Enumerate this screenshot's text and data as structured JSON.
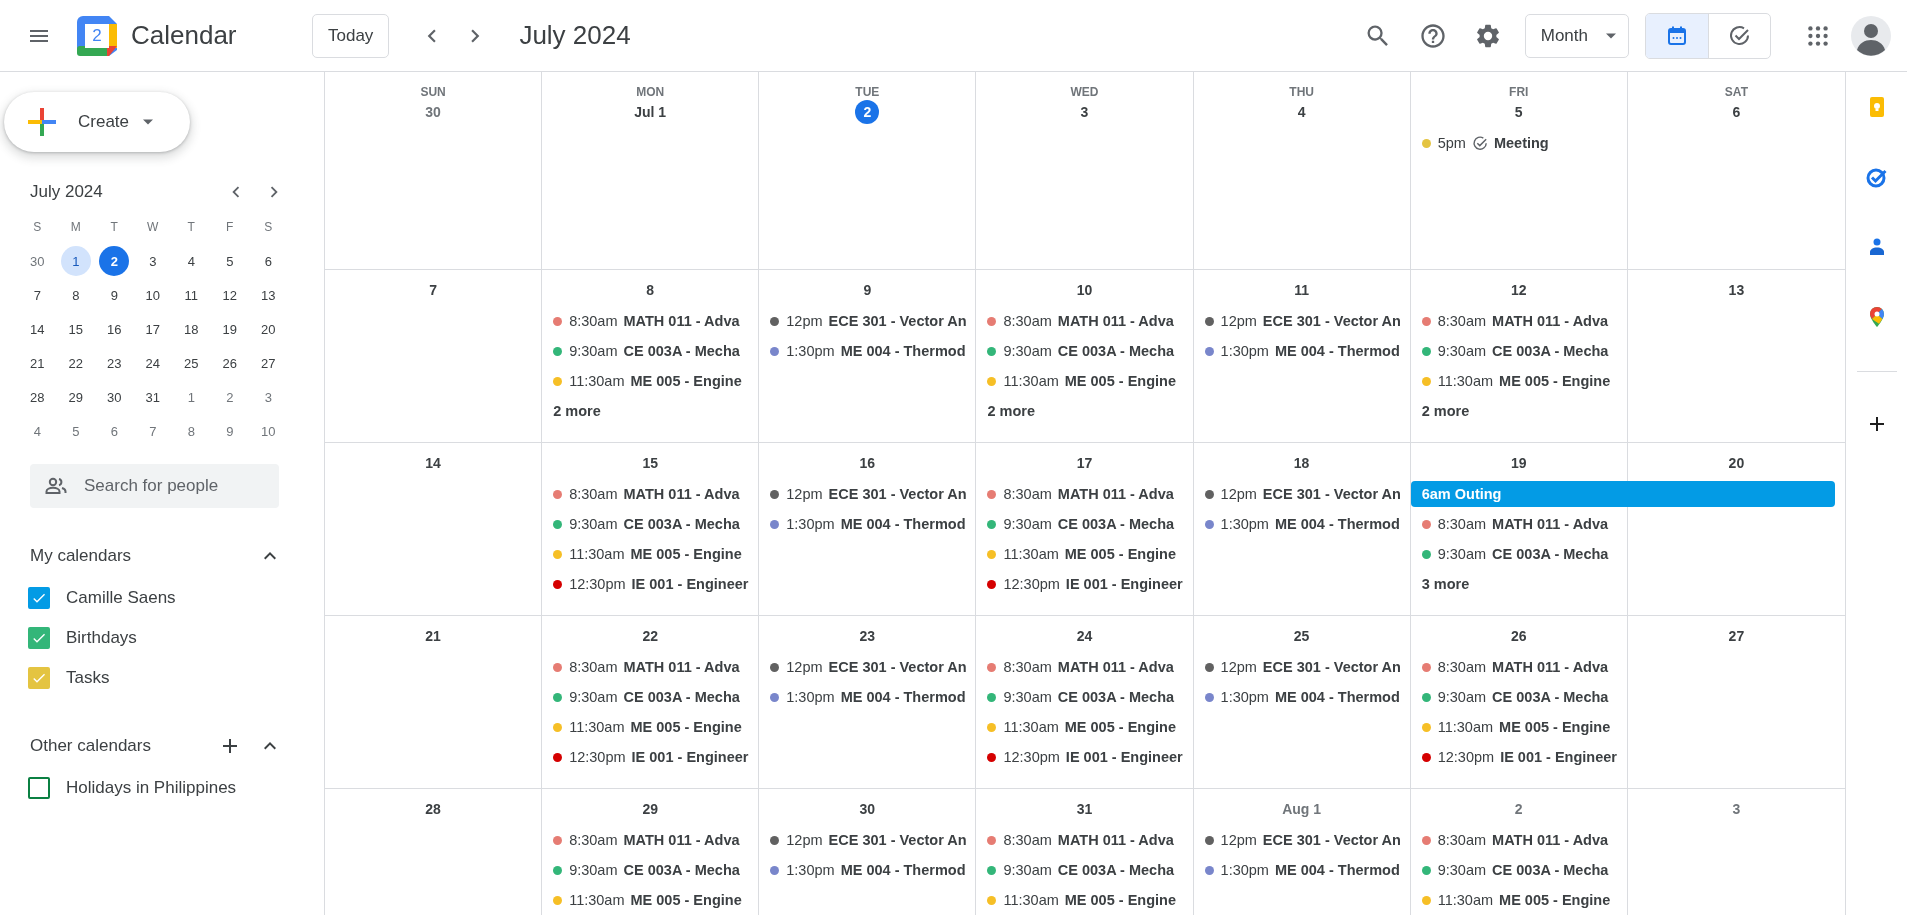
{
  "topbar": {
    "logo_date": "2",
    "app_name": "Calendar",
    "today_button": "Today",
    "title": "July 2024",
    "view_select": "Month",
    "view_toggle": [
      {
        "kind": "calendar",
        "selected": true
      },
      {
        "kind": "tasks",
        "selected": false
      }
    ]
  },
  "sidebar": {
    "create_button": "Create",
    "mini_calendar": {
      "title": "July 2024",
      "weekdays": [
        "S",
        "M",
        "T",
        "W",
        "T",
        "F",
        "S"
      ],
      "weeks": [
        [
          {
            "label": "30",
            "other_month": true,
            "selected": false,
            "today": false
          },
          {
            "label": "1",
            "other_month": false,
            "selected": true,
            "today": false
          },
          {
            "label": "2",
            "other_month": false,
            "selected": false,
            "today": true
          },
          {
            "label": "3",
            "other_month": false,
            "selected": false,
            "today": false
          },
          {
            "label": "4",
            "other_month": false,
            "selected": false,
            "today": false
          },
          {
            "label": "5",
            "other_month": false,
            "selected": false,
            "today": false
          },
          {
            "label": "6",
            "other_month": false,
            "selected": false,
            "today": false
          }
        ],
        [
          {
            "label": "7",
            "other_month": false,
            "selected": false,
            "today": false
          },
          {
            "label": "8",
            "other_month": false,
            "selected": false,
            "today": false
          },
          {
            "label": "9",
            "other_month": false,
            "selected": false,
            "today": false
          },
          {
            "label": "10",
            "other_month": false,
            "selected": false,
            "today": false
          },
          {
            "label": "11",
            "other_month": false,
            "selected": false,
            "today": false
          },
          {
            "label": "12",
            "other_month": false,
            "selected": false,
            "today": false
          },
          {
            "label": "13",
            "other_month": false,
            "selected": false,
            "today": false
          }
        ],
        [
          {
            "label": "14",
            "other_month": false,
            "selected": false,
            "today": false
          },
          {
            "label": "15",
            "other_month": false,
            "selected": false,
            "today": false
          },
          {
            "label": "16",
            "other_month": false,
            "selected": false,
            "today": false
          },
          {
            "label": "17",
            "other_month": false,
            "selected": false,
            "today": false
          },
          {
            "label": "18",
            "other_month": false,
            "selected": false,
            "today": false
          },
          {
            "label": "19",
            "other_month": false,
            "selected": false,
            "today": false
          },
          {
            "label": "20",
            "other_month": false,
            "selected": false,
            "today": false
          }
        ],
        [
          {
            "label": "21",
            "other_month": false,
            "selected": false,
            "today": false
          },
          {
            "label": "22",
            "other_month": false,
            "selected": false,
            "today": false
          },
          {
            "label": "23",
            "other_month": false,
            "selected": false,
            "today": false
          },
          {
            "label": "24",
            "other_month": false,
            "selected": false,
            "today": false
          },
          {
            "label": "25",
            "other_month": false,
            "selected": false,
            "today": false
          },
          {
            "label": "26",
            "other_month": false,
            "selected": false,
            "today": false
          },
          {
            "label": "27",
            "other_month": false,
            "selected": false,
            "today": false
          }
        ],
        [
          {
            "label": "28",
            "other_month": false,
            "selected": false,
            "today": false
          },
          {
            "label": "29",
            "other_month": false,
            "selected": false,
            "today": false
          },
          {
            "label": "30",
            "other_month": false,
            "selected": false,
            "today": false
          },
          {
            "label": "31",
            "other_month": false,
            "selected": false,
            "today": false
          },
          {
            "label": "1",
            "other_month": true,
            "selected": false,
            "today": false
          },
          {
            "label": "2",
            "other_month": true,
            "selected": false,
            "today": false
          },
          {
            "label": "3",
            "other_month": true,
            "selected": false,
            "today": false
          }
        ],
        [
          {
            "label": "4",
            "other_month": true,
            "selected": false,
            "today": false
          },
          {
            "label": "5",
            "other_month": true,
            "selected": false,
            "today": false
          },
          {
            "label": "6",
            "other_month": true,
            "selected": false,
            "today": false
          },
          {
            "label": "7",
            "other_month": true,
            "selected": false,
            "today": false
          },
          {
            "label": "8",
            "other_month": true,
            "selected": false,
            "today": false
          },
          {
            "label": "9",
            "other_month": true,
            "selected": false,
            "today": false
          },
          {
            "label": "10",
            "other_month": true,
            "selected": false,
            "today": false
          }
        ]
      ]
    },
    "people_search": {
      "placeholder": "Search for people"
    },
    "calendar_groups": [
      {
        "title": "My calendars",
        "expanded": true,
        "can_add": false,
        "items": [
          {
            "label": "Camille Saens",
            "checked": true,
            "color": "#039be5"
          },
          {
            "label": "Birthdays",
            "checked": true,
            "color": "#33b679"
          },
          {
            "label": "Tasks",
            "checked": true,
            "color": "#e4c441"
          }
        ]
      },
      {
        "title": "Other calendars",
        "expanded": true,
        "can_add": true,
        "items": [
          {
            "label": "Holidays in Philippines",
            "checked": false,
            "color": "#0b8043"
          }
        ]
      }
    ]
  },
  "month_grid": {
    "weekdays": [
      "SUN",
      "MON",
      "TUE",
      "WED",
      "THU",
      "FRI",
      "SAT"
    ],
    "weeks": [
      {
        "days": [
          {
            "date": "30",
            "other_month": true,
            "today": false
          },
          {
            "date": "Jul 1",
            "other_month": false,
            "today": false
          },
          {
            "date": "2",
            "other_month": false,
            "today": true
          },
          {
            "date": "3",
            "other_month": false,
            "today": false
          },
          {
            "date": "4",
            "other_month": false,
            "today": false
          },
          {
            "date": "5",
            "other_month": false,
            "today": false,
            "events": [
              {
                "time": "5pm",
                "title": "Meeting",
                "color": "#e4c441",
                "kind": "task"
              }
            ]
          },
          {
            "date": "6",
            "other_month": false,
            "today": false
          }
        ]
      },
      {
        "days": [
          {
            "date": "7",
            "other_month": false,
            "today": false
          },
          {
            "date": "8",
            "other_month": false,
            "today": false,
            "events": [
              {
                "time": "8:30am",
                "title": "MATH 011 - Adva",
                "color": "#e67c73",
                "kind": "event"
              },
              {
                "time": "9:30am",
                "title": "CE 003A - Mecha",
                "color": "#33b679",
                "kind": "event"
              },
              {
                "time": "11:30am",
                "title": "ME 005 - Engine",
                "color": "#f6bf26",
                "kind": "event"
              }
            ],
            "more": "2 more"
          },
          {
            "date": "9",
            "other_month": false,
            "today": false,
            "events": [
              {
                "time": "12pm",
                "title": "ECE 301 - Vector An",
                "color": "#616161",
                "kind": "event"
              },
              {
                "time": "1:30pm",
                "title": "ME 004 - Thermod",
                "color": "#7986cb",
                "kind": "event"
              }
            ]
          },
          {
            "date": "10",
            "other_month": false,
            "today": false,
            "events": [
              {
                "time": "8:30am",
                "title": "MATH 011 - Adva",
                "color": "#e67c73",
                "kind": "event"
              },
              {
                "time": "9:30am",
                "title": "CE 003A - Mecha",
                "color": "#33b679",
                "kind": "event"
              },
              {
                "time": "11:30am",
                "title": "ME 005 - Engine",
                "color": "#f6bf26",
                "kind": "event"
              }
            ],
            "more": "2 more"
          },
          {
            "date": "11",
            "other_month": false,
            "today": false,
            "events": [
              {
                "time": "12pm",
                "title": "ECE 301 - Vector An",
                "color": "#616161",
                "kind": "event"
              },
              {
                "time": "1:30pm",
                "title": "ME 004 - Thermod",
                "color": "#7986cb",
                "kind": "event"
              }
            ]
          },
          {
            "date": "12",
            "other_month": false,
            "today": false,
            "events": [
              {
                "time": "8:30am",
                "title": "MATH 011 - Adva",
                "color": "#e67c73",
                "kind": "event"
              },
              {
                "time": "9:30am",
                "title": "CE 003A - Mecha",
                "color": "#33b679",
                "kind": "event"
              },
              {
                "time": "11:30am",
                "title": "ME 005 - Engine",
                "color": "#f6bf26",
                "kind": "event"
              }
            ],
            "more": "2 more"
          },
          {
            "date": "13",
            "other_month": false,
            "today": false
          }
        ]
      },
      {
        "days": [
          {
            "date": "14",
            "other_month": false,
            "today": false
          },
          {
            "date": "15",
            "other_month": false,
            "today": false,
            "events": [
              {
                "time": "8:30am",
                "title": "MATH 011 - Adva",
                "color": "#e67c73",
                "kind": "event"
              },
              {
                "time": "9:30am",
                "title": "CE 003A - Mecha",
                "color": "#33b679",
                "kind": "event"
              },
              {
                "time": "11:30am",
                "title": "ME 005 - Engine",
                "color": "#f6bf26",
                "kind": "event"
              },
              {
                "time": "12:30pm",
                "title": "IE 001 - Engineer",
                "color": "#d50000",
                "kind": "event"
              }
            ]
          },
          {
            "date": "16",
            "other_month": false,
            "today": false,
            "events": [
              {
                "time": "12pm",
                "title": "ECE 301 - Vector An",
                "color": "#616161",
                "kind": "event"
              },
              {
                "time": "1:30pm",
                "title": "ME 004 - Thermod",
                "color": "#7986cb",
                "kind": "event"
              }
            ]
          },
          {
            "date": "17",
            "other_month": false,
            "today": false,
            "events": [
              {
                "time": "8:30am",
                "title": "MATH 011 - Adva",
                "color": "#e67c73",
                "kind": "event"
              },
              {
                "time": "9:30am",
                "title": "CE 003A - Mecha",
                "color": "#33b679",
                "kind": "event"
              },
              {
                "time": "11:30am",
                "title": "ME 005 - Engine",
                "color": "#f6bf26",
                "kind": "event"
              },
              {
                "time": "12:30pm",
                "title": "IE 001 - Engineer",
                "color": "#d50000",
                "kind": "event"
              }
            ]
          },
          {
            "date": "18",
            "other_month": false,
            "today": false,
            "events": [
              {
                "time": "12pm",
                "title": "ECE 301 - Vector An",
                "color": "#616161",
                "kind": "event"
              },
              {
                "time": "1:30pm",
                "title": "ME 004 - Thermod",
                "color": "#7986cb",
                "kind": "event"
              }
            ]
          },
          {
            "date": "19",
            "other_month": false,
            "today": false,
            "banner": {
              "text": "6am Outing",
              "color": "#039be5",
              "continues": true
            },
            "events": [
              {
                "time": "8:30am",
                "title": "MATH 011 - Adva",
                "color": "#e67c73",
                "kind": "event"
              },
              {
                "time": "9:30am",
                "title": "CE 003A - Mecha",
                "color": "#33b679",
                "kind": "event"
              }
            ],
            "more": "3 more"
          },
          {
            "date": "20",
            "other_month": false,
            "today": false,
            "covered": true
          }
        ]
      },
      {
        "days": [
          {
            "date": "21",
            "other_month": false,
            "today": false
          },
          {
            "date": "22",
            "other_month": false,
            "today": false,
            "events": [
              {
                "time": "8:30am",
                "title": "MATH 011 - Adva",
                "color": "#e67c73",
                "kind": "event"
              },
              {
                "time": "9:30am",
                "title": "CE 003A - Mecha",
                "color": "#33b679",
                "kind": "event"
              },
              {
                "time": "11:30am",
                "title": "ME 005 - Engine",
                "color": "#f6bf26",
                "kind": "event"
              },
              {
                "time": "12:30pm",
                "title": "IE 001 - Engineer",
                "color": "#d50000",
                "kind": "event"
              }
            ]
          },
          {
            "date": "23",
            "other_month": false,
            "today": false,
            "events": [
              {
                "time": "12pm",
                "title": "ECE 301 - Vector An",
                "color": "#616161",
                "kind": "event"
              },
              {
                "time": "1:30pm",
                "title": "ME 004 - Thermod",
                "color": "#7986cb",
                "kind": "event"
              }
            ]
          },
          {
            "date": "24",
            "other_month": false,
            "today": false,
            "events": [
              {
                "time": "8:30am",
                "title": "MATH 011 - Adva",
                "color": "#e67c73",
                "kind": "event"
              },
              {
                "time": "9:30am",
                "title": "CE 003A - Mecha",
                "color": "#33b679",
                "kind": "event"
              },
              {
                "time": "11:30am",
                "title": "ME 005 - Engine",
                "color": "#f6bf26",
                "kind": "event"
              },
              {
                "time": "12:30pm",
                "title": "IE 001 - Engineer",
                "color": "#d50000",
                "kind": "event"
              }
            ]
          },
          {
            "date": "25",
            "other_month": false,
            "today": false,
            "events": [
              {
                "time": "12pm",
                "title": "ECE 301 - Vector An",
                "color": "#616161",
                "kind": "event"
              },
              {
                "time": "1:30pm",
                "title": "ME 004 - Thermod",
                "color": "#7986cb",
                "kind": "event"
              }
            ]
          },
          {
            "date": "26",
            "other_month": false,
            "today": false,
            "events": [
              {
                "time": "8:30am",
                "title": "MATH 011 - Adva",
                "color": "#e67c73",
                "kind": "event"
              },
              {
                "time": "9:30am",
                "title": "CE 003A - Mecha",
                "color": "#33b679",
                "kind": "event"
              },
              {
                "time": "11:30am",
                "title": "ME 005 - Engine",
                "color": "#f6bf26",
                "kind": "event"
              },
              {
                "time": "12:30pm",
                "title": "IE 001 - Engineer",
                "color": "#d50000",
                "kind": "event"
              }
            ]
          },
          {
            "date": "27",
            "other_month": false,
            "today": false
          }
        ]
      },
      {
        "days": [
          {
            "date": "28",
            "other_month": false,
            "today": false
          },
          {
            "date": "29",
            "other_month": false,
            "today": false,
            "events": [
              {
                "time": "8:30am",
                "title": "MATH 011 - Adva",
                "color": "#e67c73",
                "kind": "event"
              },
              {
                "time": "9:30am",
                "title": "CE 003A - Mecha",
                "color": "#33b679",
                "kind": "event"
              },
              {
                "time": "11:30am",
                "title": "ME 005 - Engine",
                "color": "#f6bf26",
                "kind": "event"
              }
            ]
          },
          {
            "date": "30",
            "other_month": false,
            "today": false,
            "events": [
              {
                "time": "12pm",
                "title": "ECE 301 - Vector An",
                "color": "#616161",
                "kind": "event"
              },
              {
                "time": "1:30pm",
                "title": "ME 004 - Thermod",
                "color": "#7986cb",
                "kind": "event"
              }
            ]
          },
          {
            "date": "31",
            "other_month": false,
            "today": false,
            "events": [
              {
                "time": "8:30am",
                "title": "MATH 011 - Adva",
                "color": "#e67c73",
                "kind": "event"
              },
              {
                "time": "9:30am",
                "title": "CE 003A - Mecha",
                "color": "#33b679",
                "kind": "event"
              },
              {
                "time": "11:30am",
                "title": "ME 005 - Engine",
                "color": "#f6bf26",
                "kind": "event"
              }
            ]
          },
          {
            "date": "Aug 1",
            "other_month": true,
            "today": false,
            "events": [
              {
                "time": "12pm",
                "title": "ECE 301 - Vector An",
                "color": "#616161",
                "kind": "event"
              },
              {
                "time": "1:30pm",
                "title": "ME 004 - Thermod",
                "color": "#7986cb",
                "kind": "event"
              }
            ]
          },
          {
            "date": "2",
            "other_month": true,
            "today": false,
            "events": [
              {
                "time": "8:30am",
                "title": "MATH 011 - Adva",
                "color": "#e67c73",
                "kind": "event"
              },
              {
                "time": "9:30am",
                "title": "CE 003A - Mecha",
                "color": "#33b679",
                "kind": "event"
              },
              {
                "time": "11:30am",
                "title": "ME 005 - Engine",
                "color": "#f6bf26",
                "kind": "event"
              }
            ]
          },
          {
            "date": "3",
            "other_month": true,
            "today": false
          }
        ]
      }
    ]
  },
  "side_panel": {
    "apps": [
      {
        "kind": "keep"
      },
      {
        "kind": "tasks"
      },
      {
        "kind": "contacts"
      },
      {
        "kind": "maps"
      }
    ]
  }
}
